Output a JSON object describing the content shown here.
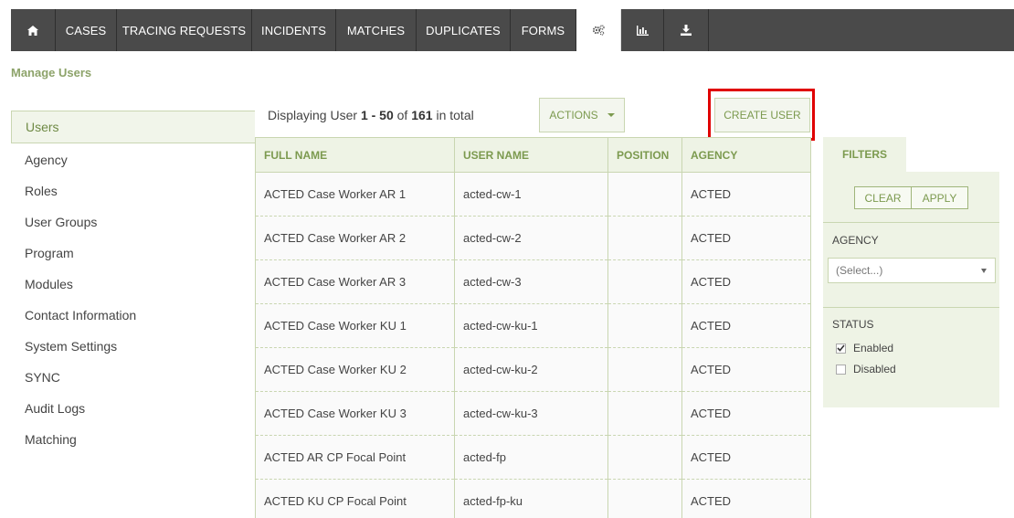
{
  "nav": {
    "items": [
      {
        "label": "",
        "icon": "home-icon"
      },
      {
        "label": "CASES"
      },
      {
        "label": "TRACING REQUESTS"
      },
      {
        "label": "INCIDENTS"
      },
      {
        "label": "MATCHES"
      },
      {
        "label": "DUPLICATES"
      },
      {
        "label": "FORMS"
      },
      {
        "label": "",
        "icon": "settings-gears-icon",
        "active": true
      },
      {
        "label": "",
        "icon": "bar-chart-icon"
      },
      {
        "label": "",
        "icon": "download-icon"
      }
    ]
  },
  "page_title": "Manage Users",
  "sidebar": {
    "items": [
      {
        "label": "Users",
        "active": true
      },
      {
        "label": "Agency"
      },
      {
        "label": "Roles"
      },
      {
        "label": "User Groups"
      },
      {
        "label": "Program"
      },
      {
        "label": "Modules"
      },
      {
        "label": "Contact Information"
      },
      {
        "label": "System Settings"
      },
      {
        "label": "SYNC"
      },
      {
        "label": "Audit Logs"
      },
      {
        "label": "Matching"
      }
    ]
  },
  "listing": {
    "prefix": "Displaying User ",
    "range": "1 - 50",
    "of_text": " of ",
    "total": "161",
    "suffix": " in total"
  },
  "toolbar": {
    "actions_label": "ACTIONS",
    "create_label": "CREATE USER"
  },
  "table": {
    "columns": [
      "FULL NAME",
      "USER NAME",
      "POSITION",
      "AGENCY"
    ],
    "rows": [
      [
        "ACTED Case Worker AR 1",
        "acted-cw-1",
        "",
        "ACTED"
      ],
      [
        "ACTED Case Worker AR 2",
        "acted-cw-2",
        "",
        "ACTED"
      ],
      [
        "ACTED Case Worker AR 3",
        "acted-cw-3",
        "",
        "ACTED"
      ],
      [
        "ACTED Case Worker KU 1",
        "acted-cw-ku-1",
        "",
        "ACTED"
      ],
      [
        "ACTED Case Worker KU 2",
        "acted-cw-ku-2",
        "",
        "ACTED"
      ],
      [
        "ACTED Case Worker KU 3",
        "acted-cw-ku-3",
        "",
        "ACTED"
      ],
      [
        "ACTED AR CP Focal Point",
        "acted-fp",
        "",
        "ACTED"
      ],
      [
        "ACTED KU CP Focal Point",
        "acted-fp-ku",
        "",
        "ACTED"
      ]
    ]
  },
  "filters": {
    "tab_label": "FILTERS",
    "clear_label": "CLEAR",
    "apply_label": "APPLY",
    "agency_label": "AGENCY",
    "agency_placeholder": "(Select...)",
    "status_label": "STATUS",
    "status_options": [
      {
        "label": "Enabled",
        "checked": true
      },
      {
        "label": "Disabled",
        "checked": false
      }
    ]
  },
  "colors": {
    "nav_bg": "#4a4a4a",
    "accent_green": "#7c9a4f",
    "highlight_red": "#e00000"
  }
}
